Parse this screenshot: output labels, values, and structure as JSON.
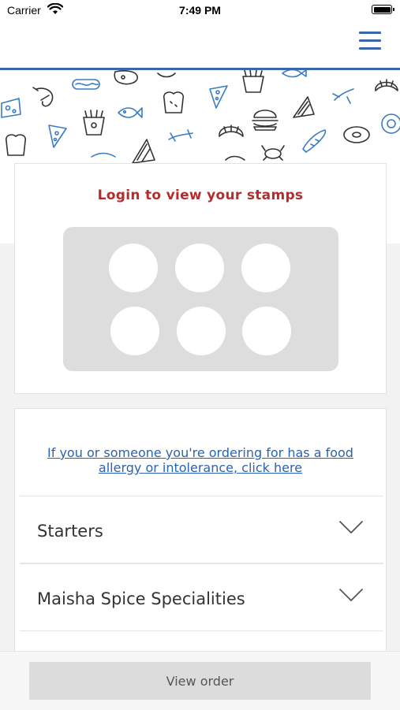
{
  "status_bar": {
    "carrier": "Carrier",
    "time": "7:49 PM"
  },
  "header": {
    "menu_icon": "hamburger-icon",
    "accent_color": "#3a66b0"
  },
  "banner": {
    "icons": [
      "cheese-icon",
      "shrimp-icon",
      "hotdog-icon",
      "steak-icon",
      "toast-icon",
      "pizza-icon",
      "fries-icon",
      "croissant-icon",
      "sandwich-icon",
      "fish-icon",
      "sausage-icon",
      "burger-icon",
      "crab-icon",
      "baguette-icon",
      "donut-icon",
      "egg-icon"
    ]
  },
  "stamp_card": {
    "title": "Login to view your stamps",
    "title_color": "#b52c2c",
    "stamp_count": 6
  },
  "allergy": {
    "link_text": "If you or someone you're ordering for has a food allergy or intolerance, click here"
  },
  "menu": {
    "categories": [
      {
        "label": "Starters"
      },
      {
        "label": "Maisha Spice Specialities"
      }
    ]
  },
  "bottom": {
    "view_order_label": "View order"
  }
}
